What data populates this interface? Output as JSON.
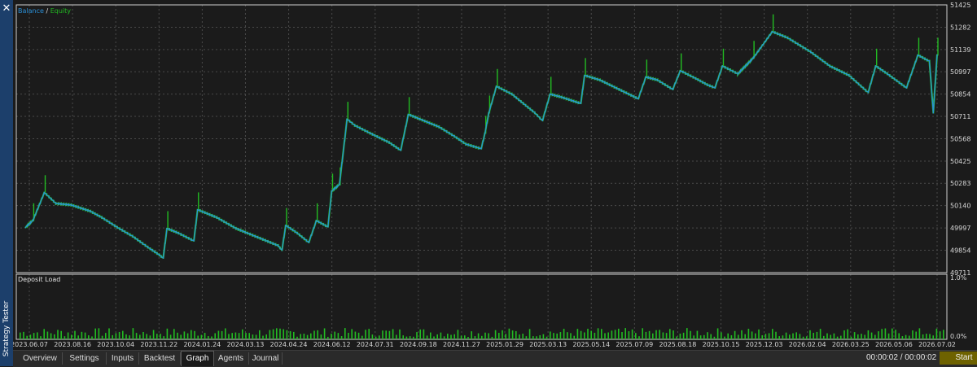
{
  "panel": {
    "title": "Strategy Tester",
    "close_glyph": "✕"
  },
  "chart": {
    "legend_balance": "Balance",
    "legend_sep": " / ",
    "legend_equity": "Equity",
    "subpanel_title": "Deposit Load",
    "colors": {
      "balance": "#2a8fd6",
      "equity": "#22bb22",
      "load": "#22bb22",
      "grid": "#4a4a4a",
      "background": "#1b1b1b"
    }
  },
  "chart_data": [
    {
      "type": "line",
      "series": [
        {
          "name": "Balance",
          "points": [
            [
              0,
              49997
            ],
            [
              2,
              50040
            ],
            [
              5,
              50220
            ],
            [
              8,
              50150
            ],
            [
              12,
              50140
            ],
            [
              17,
              50100
            ],
            [
              20,
              50060
            ],
            [
              24,
              49997
            ],
            [
              28,
              49940
            ],
            [
              32,
              49870
            ],
            [
              35,
              49820
            ],
            [
              36,
              49800
            ],
            [
              37,
              49990
            ],
            [
              40,
              49960
            ],
            [
              44,
              49910
            ],
            [
              45,
              50110
            ],
            [
              50,
              50060
            ],
            [
              55,
              49990
            ],
            [
              58,
              49960
            ],
            [
              62,
              49920
            ],
            [
              66,
              49880
            ],
            [
              67,
              49850
            ],
            [
              68,
              50010
            ],
            [
              71,
              49960
            ],
            [
              74,
              49900
            ],
            [
              76,
              50040
            ],
            [
              79,
              50000
            ],
            [
              80,
              50230
            ],
            [
              82,
              50270
            ],
            [
              84,
              50690
            ],
            [
              86,
              50650
            ],
            [
              90,
              50600
            ],
            [
              95,
              50540
            ],
            [
              98,
              50490
            ],
            [
              100,
              50720
            ],
            [
              103,
              50690
            ],
            [
              108,
              50640
            ],
            [
              112,
              50580
            ],
            [
              115,
              50530
            ],
            [
              119,
              50500
            ],
            [
              120,
              50600
            ],
            [
              121,
              50730
            ],
            [
              123,
              50900
            ],
            [
              127,
              50850
            ],
            [
              130,
              50790
            ],
            [
              133,
              50730
            ],
            [
              135,
              50680
            ],
            [
              137,
              50850
            ],
            [
              140,
              50830
            ],
            [
              145,
              50790
            ],
            [
              146,
              50970
            ],
            [
              150,
              50940
            ],
            [
              155,
              50880
            ],
            [
              160,
              50820
            ],
            [
              162,
              50960
            ],
            [
              165,
              50940
            ],
            [
              169,
              50880
            ],
            [
              171,
              51000
            ],
            [
              175,
              50950
            ],
            [
              178,
              50910
            ],
            [
              180,
              50890
            ],
            [
              182,
              51030
            ],
            [
              186,
              50980
            ],
            [
              190,
              51080
            ],
            [
              195,
              51250
            ],
            [
              199,
              51210
            ],
            [
              205,
              51120
            ],
            [
              210,
              51030
            ],
            [
              215,
              50970
            ],
            [
              220,
              50860
            ],
            [
              222,
              51030
            ],
            [
              225,
              50980
            ],
            [
              230,
              50890
            ],
            [
              233,
              51100
            ],
            [
              236,
              51060
            ],
            [
              237,
              50730
            ],
            [
              238,
              51100
            ]
          ]
        },
        {
          "name": "Equity"
        }
      ],
      "y_ticks": [
        "51425",
        "51282",
        "51139",
        "50997",
        "50854",
        "50711",
        "50568",
        "50425",
        "50283",
        "50140",
        "49997",
        "49854",
        "49711"
      ],
      "ylim": [
        49711,
        51425
      ],
      "x_ticks": [
        "2023.06.07",
        "2023.08.16",
        "2023.10.04",
        "2023.11.22",
        "2024.01.24",
        "2024.03.13",
        "2024.04.24",
        "2024.06.12",
        "2024.07.31",
        "2024.09.18",
        "2024.11.27",
        "2025.01.29",
        "2025.03.13",
        "2025.05.14",
        "2025.07.09",
        "2025.08.18",
        "2025.10.15",
        "2025.12.03",
        "2026.02.04",
        "2026.03.25",
        "2026.05.06",
        "2026.07.02"
      ]
    },
    {
      "type": "bar",
      "name": "Deposit Load",
      "y_ticks": [
        "1.0%",
        "0.0%"
      ],
      "ylim": [
        0,
        1.0
      ]
    }
  ],
  "tabs": [
    {
      "label": "Overview"
    },
    {
      "label": "Settings"
    },
    {
      "label": "Inputs"
    },
    {
      "label": "Backtest"
    },
    {
      "label": "Graph"
    },
    {
      "label": "Agents"
    },
    {
      "label": "Journal"
    }
  ],
  "status": {
    "timer": "00:00:02 / 00:00:02",
    "start_label": "Start"
  }
}
